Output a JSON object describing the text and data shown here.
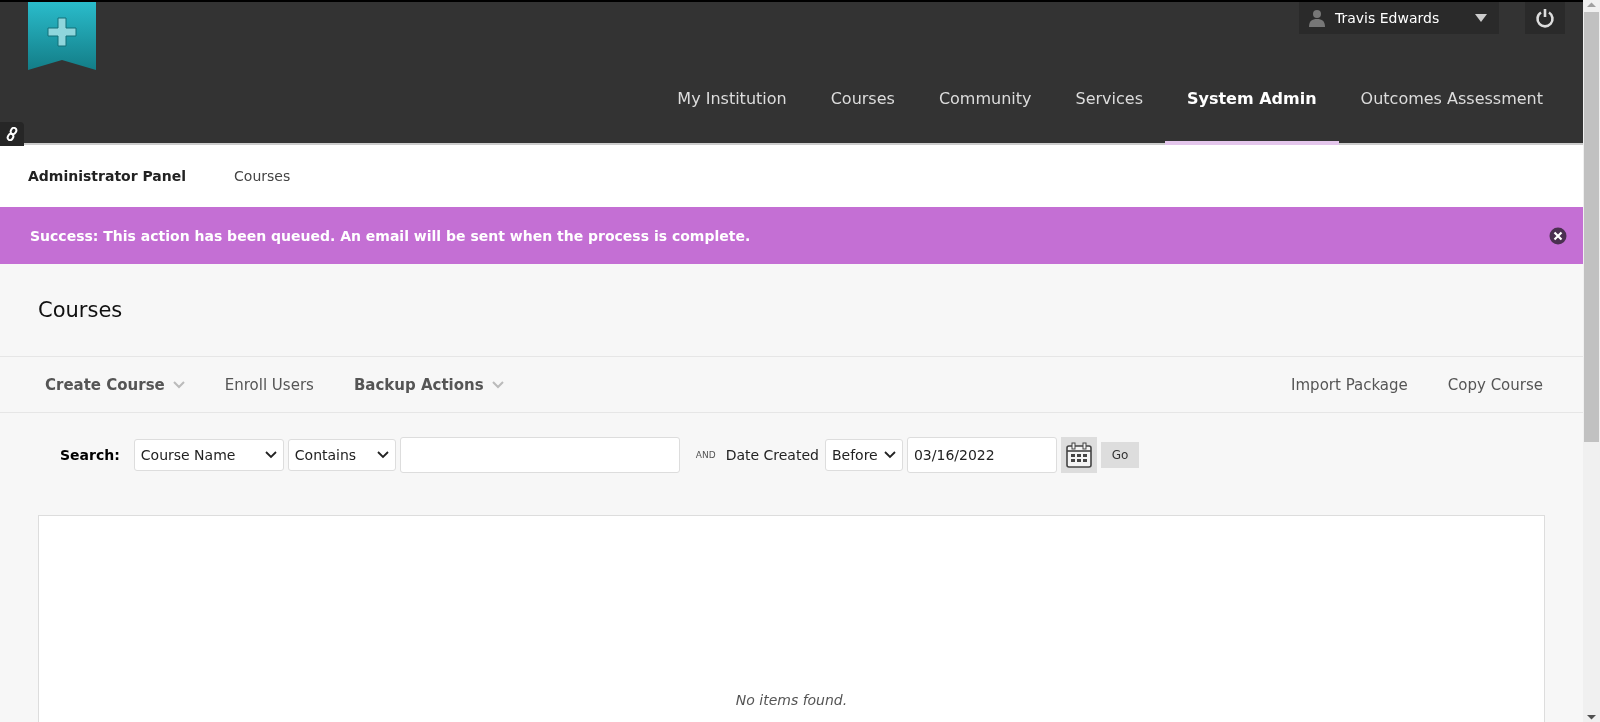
{
  "header": {
    "user": {
      "name": "Travis Edwards"
    },
    "tabs": [
      {
        "label": "My Institution",
        "selected": false
      },
      {
        "label": "Courses",
        "selected": false
      },
      {
        "label": "Community",
        "selected": false
      },
      {
        "label": "Services",
        "selected": false
      },
      {
        "label": "System Admin",
        "selected": true
      },
      {
        "label": "Outcomes Assessment",
        "selected": false
      }
    ]
  },
  "breadcrumbs": [
    {
      "label": "Administrator Panel",
      "current": false
    },
    {
      "label": "Courses",
      "current": true
    }
  ],
  "alert": {
    "message": "Success: This action has been queued. An email will be sent when the process is complete."
  },
  "page_title": "Courses",
  "toolbar": {
    "left": [
      {
        "label": "Create Course",
        "kind": "menu"
      },
      {
        "label": "Enroll Users",
        "kind": "link"
      },
      {
        "label": "Backup Actions",
        "kind": "menu"
      }
    ],
    "right": [
      {
        "label": "Import Package"
      },
      {
        "label": "Copy Course"
      }
    ]
  },
  "search": {
    "label": "Search:",
    "field": "Course Name",
    "operator": "Contains",
    "conjunction": "AND",
    "date_label": "Date Created",
    "date_operator": "Before",
    "date": "03/16/2022",
    "go": "Go"
  },
  "results": {
    "empty_message": "No items found."
  }
}
